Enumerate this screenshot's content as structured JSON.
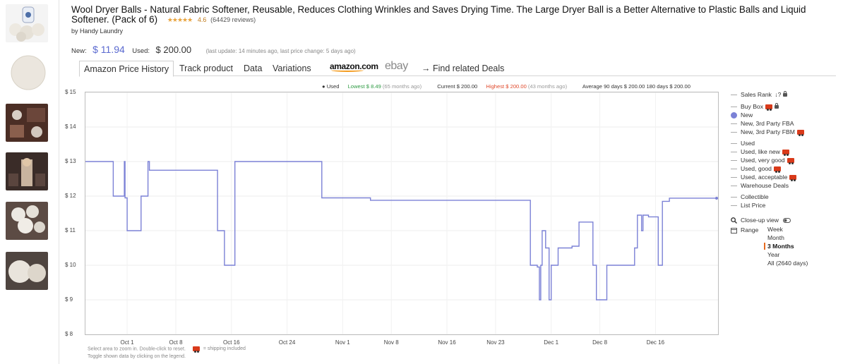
{
  "product": {
    "title": "Wool Dryer Balls - Natural Fabric Softener, Reusable, Reduces Clothing Wrinkles and Saves Drying Time. The Large Dryer Ball is a Better Alternative to Plastic Balls and Liquid Softener. (Pack of 6)",
    "stars": "★★★★★",
    "rating": "4.6",
    "reviews": "(64429 reviews)",
    "byline": "by Handy Laundry"
  },
  "prices": {
    "new_label": "New:",
    "new_price": "$ 11.94",
    "used_label": "Used:",
    "used_price": "$ 200.00",
    "update": "(last update: 14 minutes ago,  last price change: 5 days ago)"
  },
  "tabs": {
    "price_history": "Amazon Price History",
    "track": "Track product",
    "data": "Data",
    "variations": "Variations",
    "amazon": "amazon.com",
    "ebay": "ebay",
    "related": "→  Find related Deals"
  },
  "stats": {
    "used": "● Used",
    "lowest": "Lowest $ 8.49",
    "lowest_ago": "(65 months ago)",
    "current": "Current $ 200.00",
    "highest": "Highest $ 200.00",
    "highest_ago": "(43 months ago)",
    "average": "Average 90 days $ 200.00  180 days $ 200.00"
  },
  "hints": {
    "zoom": "Select area to zoom in. Double-click to reset.",
    "shipping": "= shipping included",
    "toggle": "Toggle shown data by clicking on the legend."
  },
  "legend": {
    "sales_rank": "Sales Rank",
    "sales_rank_mark": "↓?",
    "buy_box": "Buy Box",
    "new": "New",
    "new_fba": "New, 3rd Party FBA",
    "new_fbm": "New, 3rd Party FBM",
    "used": "Used",
    "used_like_new": "Used, like new",
    "used_very_good": "Used, very good",
    "used_good": "Used, good",
    "used_acceptable": "Used, acceptable",
    "warehouse": "Warehouse Deals",
    "collectible": "Collectible",
    "list_price": "List Price",
    "closeup": "Close-up view",
    "range_label": "Range",
    "ranges": [
      "Week",
      "Month",
      "3 Months",
      "Year",
      "All (2640 days)"
    ],
    "selected_range": "3 Months"
  },
  "colors": {
    "new_series": "#7b81d6",
    "lowest": "#2f9b44",
    "highest": "#e04a2c",
    "price_new": "#5b6ad0",
    "range_marker": "#e66a1e"
  },
  "icons": [
    "search-icon",
    "calendar-icon",
    "toggle-icon",
    "lock-icon",
    "truck-icon",
    "star-icon"
  ],
  "chart_data": {
    "type": "line",
    "title": "",
    "xlabel": "",
    "ylabel": "",
    "ylim": [
      8,
      15
    ],
    "y_ticks": [
      "$ 15",
      "$ 14",
      "$ 13",
      "$ 12",
      "$ 11",
      "$ 10",
      "$ 9",
      "$ 8"
    ],
    "x_ticks": [
      "Oct 1",
      "Oct 8",
      "Oct 16",
      "Oct 24",
      "Nov 1",
      "Nov 8",
      "Nov 16",
      "Nov 23",
      "Dec 1",
      "Dec 8",
      "Dec 16"
    ],
    "grid": true,
    "series": [
      {
        "name": "New",
        "step": true,
        "points": [
          [
            "Sep 25",
            13.0
          ],
          [
            "Sep 29",
            12.0
          ],
          [
            "Sep 30.5",
            12.0
          ],
          [
            "Sep 30.6",
            13.0
          ],
          [
            "Sep 30.7",
            11.95
          ],
          [
            "Oct 1",
            11.0
          ],
          [
            "Oct 3",
            12.0
          ],
          [
            "Oct 4",
            13.0
          ],
          [
            "Oct 4.2",
            12.75
          ],
          [
            "Oct 14",
            11.0
          ],
          [
            "Oct 15",
            10.0
          ],
          [
            "Oct 16.5",
            13.0
          ],
          [
            "Oct 29",
            11.95
          ],
          [
            "Nov 5",
            11.88
          ],
          [
            "Nov 28",
            10.0
          ],
          [
            "Nov 29",
            9.95
          ],
          [
            "Nov 29.3",
            9.0
          ],
          [
            "Nov 29.5",
            10.0
          ],
          [
            "Nov 29.7",
            11.0
          ],
          [
            "Nov 30.2",
            10.5
          ],
          [
            "Nov 30.7",
            9.0
          ],
          [
            "Dec 1",
            10.0
          ],
          [
            "Dec 2",
            10.5
          ],
          [
            "Dec 4",
            10.55
          ],
          [
            "Dec 5",
            11.25
          ],
          [
            "Dec 7",
            10.0
          ],
          [
            "Dec 7.5",
            9.0
          ],
          [
            "Dec 9",
            10.0
          ],
          [
            "Dec 13",
            10.5
          ],
          [
            "Dec 13.4",
            11.45
          ],
          [
            "Dec 14",
            11.0
          ],
          [
            "Dec 14.2",
            11.45
          ],
          [
            "Dec 15",
            11.4
          ],
          [
            "Dec 15.4",
            11.4
          ],
          [
            "Dec 16.4",
            10.0
          ],
          [
            "Dec 17",
            11.85
          ],
          [
            "Dec 18",
            11.94
          ],
          [
            "Dec 25",
            11.94
          ]
        ]
      }
    ]
  }
}
